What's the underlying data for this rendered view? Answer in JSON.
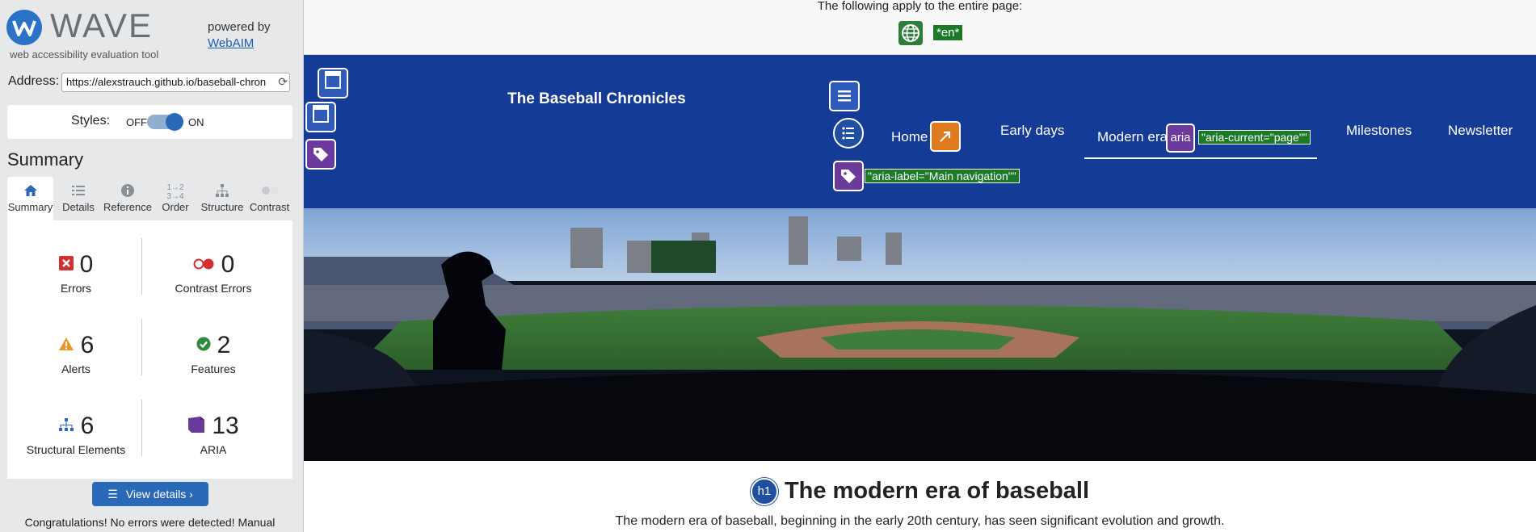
{
  "wave": {
    "logo_text": "WAVE",
    "tagline": "web accessibility evaluation tool",
    "powered_by": "powered by",
    "webaim_link": "WebAIM",
    "address_label": "Address:",
    "address_value": "https://alexstrauch.github.io/baseball-chron",
    "styles_label": "Styles:",
    "styles_off": "OFF",
    "styles_on": "ON",
    "summary_heading": "Summary",
    "tabs": [
      {
        "label": "Summary",
        "icon": "home-icon"
      },
      {
        "label": "Details",
        "icon": "list-icon"
      },
      {
        "label": "Reference",
        "icon": "info-icon"
      },
      {
        "label": "Order",
        "icon": "order-icon"
      },
      {
        "label": "Structure",
        "icon": "structure-icon"
      },
      {
        "label": "Contrast",
        "icon": "contrast-icon"
      }
    ],
    "stats": {
      "errors": {
        "count": "0",
        "label": "Errors",
        "color": "#d32f2f"
      },
      "contrast_errors": {
        "count": "0",
        "label": "Contrast Errors",
        "color": "#d32f2f"
      },
      "alerts": {
        "count": "6",
        "label": "Alerts",
        "color": "#e8962b"
      },
      "features": {
        "count": "2",
        "label": "Features",
        "color": "#2e8b3e"
      },
      "structural": {
        "count": "6",
        "label": "Structural Elements",
        "color": "#2a68b8"
      },
      "aria": {
        "count": "13",
        "label": "ARIA",
        "color": "#6a3a9c"
      }
    },
    "view_details": "View details ›",
    "congrats": "Congratulations! No errors were detected! Manual"
  },
  "page": {
    "entire_page_text": "The following apply to the entire page:",
    "lang_badge": "*en*",
    "site_title": "The Baseball Chronicles",
    "nav": [
      "Home",
      "Early days",
      "Modern era",
      "Milestones",
      "Newsletter"
    ],
    "aria_current": "\"aria-current=\"page\"\"",
    "aria_label": "\"aria-label=\"Main navigation\"\"",
    "aria_badge": "aria",
    "h1_badge": "h1",
    "h1": "The modern era of baseball",
    "intro": "The modern era of baseball, beginning in the early 20th century, has seen significant evolution and growth."
  },
  "colors": {
    "nav_background": "#143c96",
    "wave_blue": "#2a68b8",
    "annotation_green": "#1a7a27",
    "aria_purple": "#6a3a9c"
  }
}
